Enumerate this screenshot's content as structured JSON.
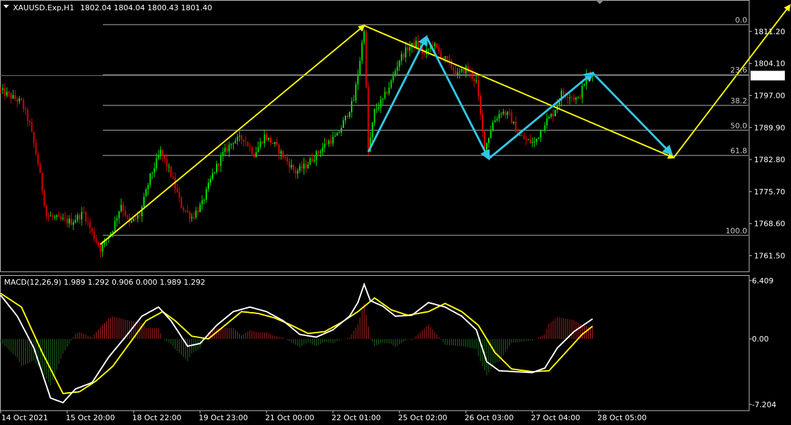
{
  "header": {
    "symbol": "XAUUSD.Exp,H1",
    "ohlc": "1802.04 1804.04 1800.43 1801.40"
  },
  "macd_label": "MACD(12,26,9) 1.989 1.292 0.906 0.000 1.989 1.292",
  "colors": {
    "background": "#000000",
    "bull": "#00e000",
    "bear": "#e00000",
    "frame": "#c0c0c0",
    "fib": "#b4b4b4",
    "yellow": "#ffff00",
    "cyan": "#33c6e6",
    "macd_line": "#ffffff",
    "signal_line": "#ffff00",
    "hist_pos": "#b02020",
    "hist_neg": "#1e6a1e",
    "current_price_bg": "#ffffff",
    "current_price_text": "#000000"
  },
  "chart_data": [
    {
      "type": "candlestick",
      "title": "XAUUSD.Exp,H1",
      "current_price": 1801.4,
      "y_ticks": [
        "1811.20",
        "1804.10",
        "1797.00",
        "1789.90",
        "1782.80",
        "1775.70",
        "1768.60",
        "1761.50"
      ],
      "x_labels": [
        "14 Oct 2021",
        "15 Oct 20:00",
        "18 Oct 22:00",
        "19 Oct 23:00",
        "21 Oct 00:00",
        "22 Oct 01:00",
        "25 Oct 02:00",
        "26 Oct 03:00",
        "27 Oct 04:00",
        "28 Oct 05:00"
      ],
      "fibonacci": [
        {
          "level": "0.0",
          "price": 1812.7
        },
        {
          "level": "23.6",
          "price": 1801.6
        },
        {
          "level": "38.2",
          "price": 1794.8
        },
        {
          "level": "50.0",
          "price": 1789.3
        },
        {
          "level": "61.8",
          "price": 1783.7
        },
        {
          "level": "100.0",
          "price": 1766.0
        }
      ],
      "close_path": [
        {
          "bar": 0,
          "price": 1798.0
        },
        {
          "bar": 10,
          "price": 1795.5
        },
        {
          "bar": 14,
          "price": 1790.5
        },
        {
          "bar": 18,
          "price": 1782.0
        },
        {
          "bar": 22,
          "price": 1770.5
        },
        {
          "bar": 28,
          "price": 1769.5
        },
        {
          "bar": 34,
          "price": 1769.0
        },
        {
          "bar": 40,
          "price": 1771.0
        },
        {
          "bar": 44,
          "price": 1766.5
        },
        {
          "bar": 48,
          "price": 1763.0
        },
        {
          "bar": 54,
          "price": 1767.5
        },
        {
          "bar": 58,
          "price": 1773.0
        },
        {
          "bar": 62,
          "price": 1768.5
        },
        {
          "bar": 67,
          "price": 1770.5
        },
        {
          "bar": 72,
          "price": 1779.0
        },
        {
          "bar": 77,
          "price": 1784.5
        },
        {
          "bar": 82,
          "price": 1779.5
        },
        {
          "bar": 87,
          "price": 1772.5
        },
        {
          "bar": 92,
          "price": 1770.0
        },
        {
          "bar": 97,
          "price": 1773.0
        },
        {
          "bar": 102,
          "price": 1779.5
        },
        {
          "bar": 107,
          "price": 1784.0
        },
        {
          "bar": 112,
          "price": 1787.0
        },
        {
          "bar": 117,
          "price": 1787.5
        },
        {
          "bar": 122,
          "price": 1784.0
        },
        {
          "bar": 127,
          "price": 1788.0
        },
        {
          "bar": 132,
          "price": 1786.0
        },
        {
          "bar": 137,
          "price": 1783.0
        },
        {
          "bar": 142,
          "price": 1780.0
        },
        {
          "bar": 147,
          "price": 1781.5
        },
        {
          "bar": 152,
          "price": 1784.0
        },
        {
          "bar": 157,
          "price": 1786.5
        },
        {
          "bar": 162,
          "price": 1788.0
        },
        {
          "bar": 167,
          "price": 1793.0
        },
        {
          "bar": 170,
          "price": 1796.0
        },
        {
          "bar": 173,
          "price": 1805.0
        },
        {
          "bar": 175,
          "price": 1812.0
        },
        {
          "bar": 177,
          "price": 1784.5
        },
        {
          "bar": 180,
          "price": 1793.5
        },
        {
          "bar": 184,
          "price": 1796.0
        },
        {
          "bar": 188,
          "price": 1800.0
        },
        {
          "bar": 192,
          "price": 1805.0
        },
        {
          "bar": 196,
          "price": 1807.5
        },
        {
          "bar": 200,
          "price": 1808.5
        },
        {
          "bar": 204,
          "price": 1806.0
        },
        {
          "bar": 208,
          "price": 1808.5
        },
        {
          "bar": 212,
          "price": 1806.0
        },
        {
          "bar": 216,
          "price": 1804.0
        },
        {
          "bar": 220,
          "price": 1801.5
        },
        {
          "bar": 224,
          "price": 1803.0
        },
        {
          "bar": 229,
          "price": 1800.0
        },
        {
          "bar": 233,
          "price": 1785.0
        },
        {
          "bar": 237,
          "price": 1791.0
        },
        {
          "bar": 241,
          "price": 1793.5
        },
        {
          "bar": 245,
          "price": 1792.5
        },
        {
          "bar": 249,
          "price": 1788.5
        },
        {
          "bar": 253,
          "price": 1787.0
        },
        {
          "bar": 257,
          "price": 1786.5
        },
        {
          "bar": 262,
          "price": 1791.0
        },
        {
          "bar": 266,
          "price": 1793.0
        },
        {
          "bar": 270,
          "price": 1797.5
        },
        {
          "bar": 274,
          "price": 1797.0
        },
        {
          "bar": 278,
          "price": 1796.0
        },
        {
          "bar": 282,
          "price": 1801.0
        },
        {
          "bar": 285,
          "price": 1801.4
        }
      ],
      "yellow_arrows": [
        {
          "from": {
            "bar": 48,
            "price": 1764.0
          },
          "to": {
            "bar": 175,
            "price": 1812.5
          }
        },
        {
          "from": {
            "bar": 175,
            "price": 1812.5
          },
          "to": {
            "bar": 324,
            "price": 1783.2
          }
        },
        {
          "from": {
            "bar": 324,
            "price": 1783.2
          },
          "to": {
            "bar": 380,
            "price": 1817.0
          }
        }
      ],
      "cyan_arrows": [
        {
          "from": {
            "bar": 177,
            "price": 1784.5
          },
          "to": {
            "bar": 205,
            "price": 1810.0
          }
        },
        {
          "from": {
            "bar": 205,
            "price": 1810.0
          },
          "to": {
            "bar": 235,
            "price": 1783.0
          }
        },
        {
          "from": {
            "bar": 235,
            "price": 1783.0
          },
          "to": {
            "bar": 285,
            "price": 1802.0
          }
        },
        {
          "from": {
            "bar": 285,
            "price": 1802.0
          },
          "to": {
            "bar": 323,
            "price": 1784.0
          }
        }
      ]
    },
    {
      "type": "macd",
      "y_ticks": [
        "6.409",
        "0.00",
        "-7.204"
      ],
      "ylim": [
        -7.204,
        6.409
      ],
      "macd_path": [
        {
          "bar": 0,
          "value": 4.8
        },
        {
          "bar": 8,
          "value": 2.5
        },
        {
          "bar": 16,
          "value": -1.0
        },
        {
          "bar": 24,
          "value": -6.5
        },
        {
          "bar": 30,
          "value": -7.0
        },
        {
          "bar": 36,
          "value": -5.5
        },
        {
          "bar": 44,
          "value": -4.8
        },
        {
          "bar": 52,
          "value": -2.0
        },
        {
          "bar": 60,
          "value": 0.2
        },
        {
          "bar": 68,
          "value": 2.5
        },
        {
          "bar": 76,
          "value": 3.5
        },
        {
          "bar": 82,
          "value": 2.0
        },
        {
          "bar": 90,
          "value": -0.8
        },
        {
          "bar": 96,
          "value": -0.5
        },
        {
          "bar": 104,
          "value": 1.5
        },
        {
          "bar": 112,
          "value": 3.0
        },
        {
          "bar": 120,
          "value": 3.5
        },
        {
          "bar": 128,
          "value": 3.0
        },
        {
          "bar": 136,
          "value": 2.0
        },
        {
          "bar": 144,
          "value": 0.5
        },
        {
          "bar": 152,
          "value": 0.2
        },
        {
          "bar": 160,
          "value": 1.0
        },
        {
          "bar": 168,
          "value": 2.5
        },
        {
          "bar": 172,
          "value": 4.0
        },
        {
          "bar": 175,
          "value": 6.0
        },
        {
          "bar": 178,
          "value": 4.2
        },
        {
          "bar": 184,
          "value": 3.6
        },
        {
          "bar": 190,
          "value": 2.5
        },
        {
          "bar": 198,
          "value": 2.6
        },
        {
          "bar": 206,
          "value": 4.0
        },
        {
          "bar": 214,
          "value": 3.5
        },
        {
          "bar": 222,
          "value": 2.5
        },
        {
          "bar": 229,
          "value": 1.0
        },
        {
          "bar": 234,
          "value": -2.5
        },
        {
          "bar": 240,
          "value": -3.5
        },
        {
          "bar": 248,
          "value": -3.6
        },
        {
          "bar": 256,
          "value": -3.7
        },
        {
          "bar": 262,
          "value": -3.2
        },
        {
          "bar": 268,
          "value": -1.0
        },
        {
          "bar": 276,
          "value": 0.8
        },
        {
          "bar": 285,
          "value": 2.2
        }
      ],
      "signal_path": [
        {
          "bar": 0,
          "value": 5.0
        },
        {
          "bar": 10,
          "value": 3.5
        },
        {
          "bar": 20,
          "value": -1.5
        },
        {
          "bar": 30,
          "value": -6.0
        },
        {
          "bar": 38,
          "value": -5.8
        },
        {
          "bar": 46,
          "value": -4.6
        },
        {
          "bar": 54,
          "value": -3.0
        },
        {
          "bar": 62,
          "value": -0.5
        },
        {
          "bar": 70,
          "value": 2.0
        },
        {
          "bar": 78,
          "value": 3.0
        },
        {
          "bar": 84,
          "value": 2.0
        },
        {
          "bar": 92,
          "value": 0.3
        },
        {
          "bar": 100,
          "value": 0.0
        },
        {
          "bar": 108,
          "value": 1.5
        },
        {
          "bar": 116,
          "value": 3.0
        },
        {
          "bar": 124,
          "value": 2.8
        },
        {
          "bar": 132,
          "value": 2.3
        },
        {
          "bar": 140,
          "value": 1.5
        },
        {
          "bar": 148,
          "value": 0.6
        },
        {
          "bar": 156,
          "value": 0.8
        },
        {
          "bar": 164,
          "value": 1.8
        },
        {
          "bar": 172,
          "value": 3.0
        },
        {
          "bar": 180,
          "value": 4.5
        },
        {
          "bar": 188,
          "value": 3.2
        },
        {
          "bar": 196,
          "value": 2.6
        },
        {
          "bar": 206,
          "value": 3.0
        },
        {
          "bar": 214,
          "value": 3.9
        },
        {
          "bar": 222,
          "value": 3.0
        },
        {
          "bar": 230,
          "value": 1.5
        },
        {
          "bar": 238,
          "value": -1.5
        },
        {
          "bar": 246,
          "value": -3.3
        },
        {
          "bar": 256,
          "value": -3.6
        },
        {
          "bar": 264,
          "value": -3.5
        },
        {
          "bar": 272,
          "value": -1.5
        },
        {
          "bar": 280,
          "value": 0.5
        },
        {
          "bar": 285,
          "value": 1.4
        }
      ]
    }
  ]
}
